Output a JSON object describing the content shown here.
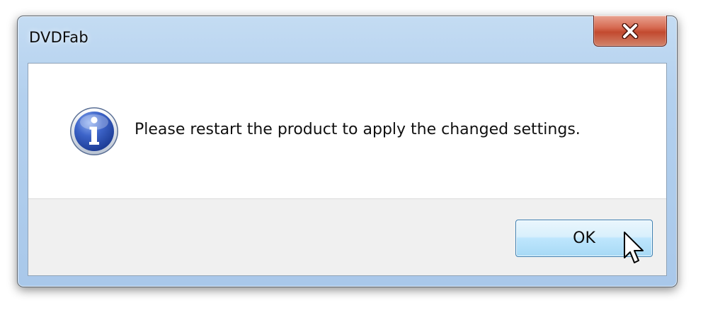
{
  "window": {
    "title": "DVDFab"
  },
  "dialog": {
    "message": "Please restart the product to apply the changed settings.",
    "ok_label": "OK",
    "icon": "info-icon"
  },
  "colors": {
    "title_bar": "#b3d0ee",
    "close_button": "#c24a2f",
    "button_bar": "#f0f0f0",
    "ok_button": "#bee6fd",
    "info_icon": "#2f53b8"
  }
}
